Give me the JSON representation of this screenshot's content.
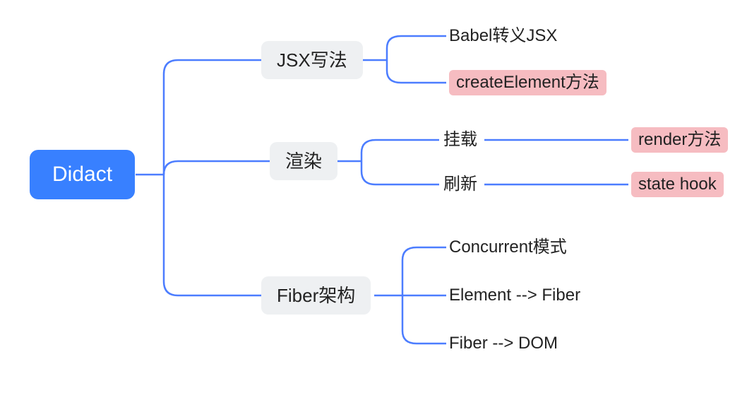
{
  "root": {
    "label": "Didact"
  },
  "level1": {
    "jsx": {
      "label": "JSX写法"
    },
    "render": {
      "label": "渲染"
    },
    "fiber": {
      "label": "Fiber架构"
    }
  },
  "jsx_children": {
    "babel": {
      "label": "Babel转义JSX"
    },
    "createElement": {
      "label": "createElement方法"
    }
  },
  "render_children": {
    "mount": {
      "label": "挂载"
    },
    "refresh": {
      "label": "刷新"
    }
  },
  "mount_children": {
    "renderMethod": {
      "label": "render方法"
    }
  },
  "refresh_children": {
    "stateHook": {
      "label": "state hook"
    }
  },
  "fiber_children": {
    "concurrent": {
      "label": "Concurrent模式"
    },
    "elementFiber": {
      "label": "Element --> Fiber"
    },
    "fiberDom": {
      "label": "Fiber --> DOM"
    }
  },
  "chart_data": {
    "type": "tree",
    "root": "Didact",
    "children": [
      {
        "label": "JSX写法",
        "children": [
          {
            "label": "Babel转义JSX"
          },
          {
            "label": "createElement方法",
            "highlight": true
          }
        ]
      },
      {
        "label": "渲染",
        "children": [
          {
            "label": "挂载",
            "children": [
              {
                "label": "render方法",
                "highlight": true
              }
            ]
          },
          {
            "label": "刷新",
            "children": [
              {
                "label": "state hook",
                "highlight": true
              }
            ]
          }
        ]
      },
      {
        "label": "Fiber架构",
        "children": [
          {
            "label": "Concurrent模式"
          },
          {
            "label": "Element --> Fiber"
          },
          {
            "label": "Fiber --> DOM"
          }
        ]
      }
    ]
  }
}
